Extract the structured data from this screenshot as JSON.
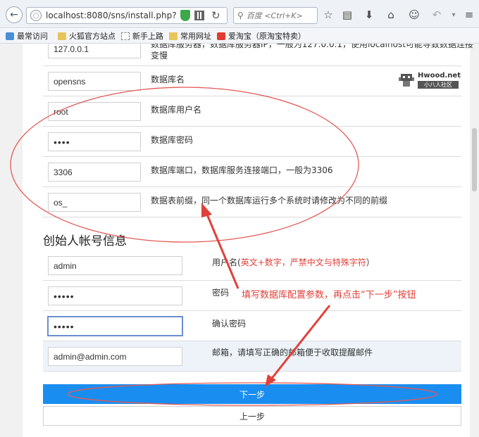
{
  "browser": {
    "url": "localhost:8080/sns/install.php?s=",
    "search_placeholder": "百度 <Ctrl+K>"
  },
  "bookmarks": [
    {
      "label": "最常访问",
      "icon": "blue"
    },
    {
      "label": "火狐官方站点",
      "icon": "folder"
    },
    {
      "label": "新手上路",
      "icon": "page"
    },
    {
      "label": "常用网址",
      "icon": "folder"
    },
    {
      "label": "爱淘宝（原淘宝特卖）",
      "icon": "red"
    }
  ],
  "db": {
    "host_value": "127.0.0.1",
    "host_desc_1": "数据库服务器，数据库服务器IP，一般为127.0.0.1，使用localhost可能导致数据连接",
    "host_desc_2": "变慢",
    "name_value": "opensns",
    "name_desc": "数据库名",
    "user_value": "root",
    "user_desc": "数据库用户名",
    "password_value": "••••",
    "password_desc": "数据库密码",
    "port_value": "3306",
    "port_desc": "数据库端口，数据库服务连接端口，一般为3306",
    "prefix_value": "os_",
    "prefix_desc": "数据表前缀，同一个数据库运行多个系统时请修改为不同的前缀"
  },
  "founder": {
    "title": "创始人帐号信息",
    "username_value": "admin",
    "username_desc_prefix": "用户名(",
    "username_desc_hint": "英文+数字，严禁中文与特殊字符",
    "username_desc_suffix": "）",
    "password_value": "•••••",
    "password_desc": "密码",
    "confirm_value": "•••••",
    "confirm_desc": "确认密码",
    "email_value": "admin@admin.com",
    "email_desc": "邮箱，请填写正确的邮箱便于收取提醒邮件"
  },
  "buttons": {
    "next": "下一步",
    "prev": "上一步"
  },
  "annotation": "填写数据库配置参数，再点击“下一步”按钮",
  "watermark": {
    "brand": "Hwood.net",
    "tag": "小八人社区"
  },
  "colors": {
    "primary_button": "#1a8ef0",
    "annotation": "#e0413a"
  }
}
